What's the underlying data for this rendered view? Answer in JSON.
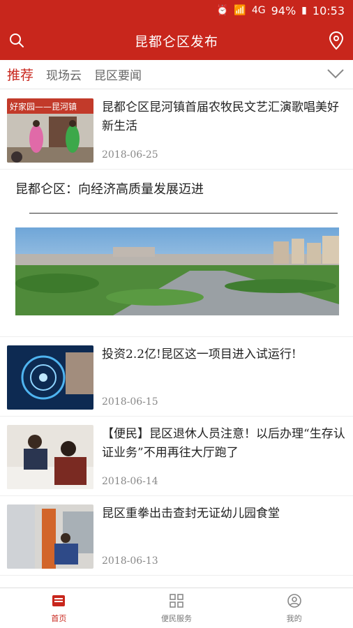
{
  "status": {
    "battery": "94%",
    "time": "10:53",
    "network": "4G"
  },
  "header": {
    "title": "昆都仑区发布"
  },
  "tabs": [
    {
      "label": "推荐"
    },
    {
      "label": "现场云"
    },
    {
      "label": "昆区要闻"
    }
  ],
  "feed": {
    "items": [
      {
        "title": "昆都仑区昆河镇首届农牧民文艺汇演歌唱美好新生活",
        "date": "2018-06-25",
        "thumb_text": "好家园——昆河镇"
      },
      {
        "title": "投资2.2亿!昆区这一项目进入试运行!",
        "date": "2018-06-15"
      },
      {
        "title": "【便民】昆区退休人员注意！以后办理“生存认证业务”不用再往大厅跑了",
        "date": "2018-06-14"
      },
      {
        "title": "昆区重拳出击查封无证幼儿园食堂",
        "date": "2018-06-13"
      }
    ],
    "feature": {
      "title": "昆都仑区：向经济高质量发展迈进"
    }
  },
  "bottom_nav": [
    {
      "label": "首页"
    },
    {
      "label": "便民服务"
    },
    {
      "label": "我的"
    }
  ],
  "colors": {
    "brand": "#c8261c"
  }
}
